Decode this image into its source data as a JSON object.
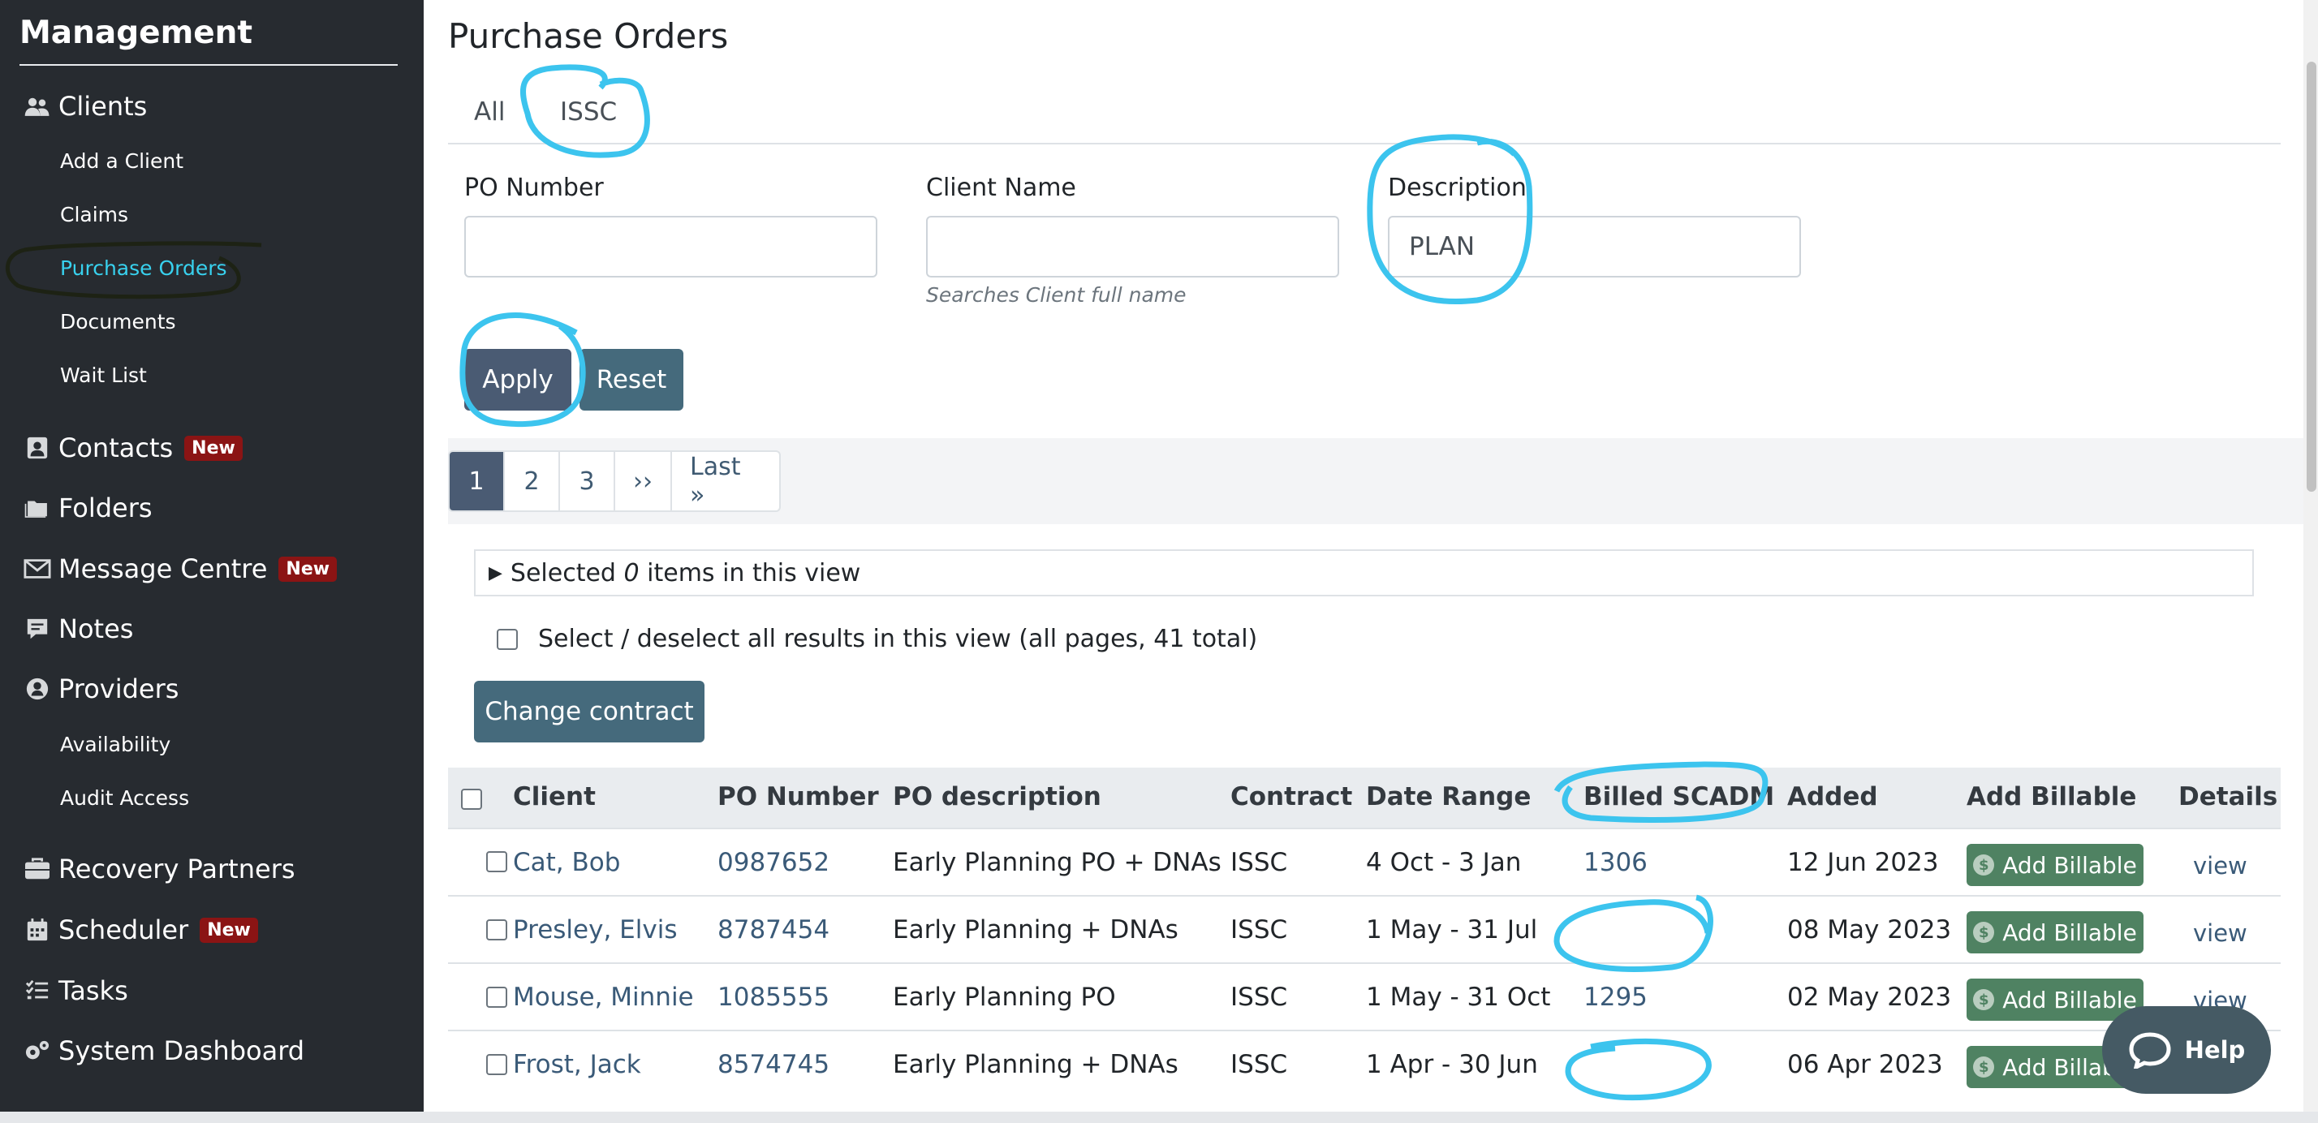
{
  "sidebar": {
    "title": "Management",
    "clients": "Clients",
    "add_client": "Add a Client",
    "claims": "Claims",
    "purchase_orders": "Purchase Orders",
    "documents": "Documents",
    "wait_list": "Wait List",
    "contacts": "Contacts",
    "folders": "Folders",
    "message_centre": "Message Centre",
    "notes": "Notes",
    "providers": "Providers",
    "availability": "Availability",
    "audit_access": "Audit Access",
    "recovery_partners": "Recovery Partners",
    "scheduler": "Scheduler",
    "tasks": "Tasks",
    "system_dashboard": "System Dashboard",
    "new_badge": "New"
  },
  "page": {
    "title": "Purchase Orders"
  },
  "tabs": {
    "all": "All",
    "issc": "ISSC"
  },
  "filters": {
    "po_number_label": "PO Number",
    "po_number_value": "",
    "client_name_label": "Client Name",
    "client_name_value": "",
    "client_name_help": "Searches Client full name",
    "description_label": "Description",
    "description_value": "PLAN",
    "apply": "Apply",
    "reset": "Reset"
  },
  "pagination": {
    "p1": "1",
    "p2": "2",
    "p3": "3",
    "next": "››",
    "last": "Last »"
  },
  "selection": {
    "summary_prefix": "Selected ",
    "count": "0",
    "summary_suffix": " items in this view",
    "select_all": "Select / deselect all results in this view (all pages, 41 total)",
    "change_contract": "Change contract"
  },
  "table": {
    "headers": {
      "client": "Client",
      "po_number": "PO Number",
      "po_description": "PO description",
      "contract": "Contract",
      "date_range": "Date Range",
      "billed": "Billed SCADM",
      "added": "Added",
      "add_billable": "Add Billable",
      "details": "Details"
    },
    "rows": [
      {
        "client": "Cat, Bob",
        "po": "0987652",
        "desc": "Early Planning PO + DNAs",
        "contract": "ISSC",
        "range": "4 Oct - 3 Jan",
        "billed": "1306",
        "added": "12 Jun 2023",
        "add": "Add Billable",
        "view": "view"
      },
      {
        "client": "Presley, Elvis",
        "po": "8787454",
        "desc": "Early Planning + DNAs",
        "contract": "ISSC",
        "range": "1 May - 31 Jul",
        "billed": "",
        "added": "08 May 2023",
        "add": "Add Billable",
        "view": "view"
      },
      {
        "client": "Mouse, Minnie",
        "po": "1085555",
        "desc": "Early Planning PO",
        "contract": "ISSC",
        "range": "1 May - 31 Oct",
        "billed": "1295",
        "added": "02 May 2023",
        "add": "Add Billable",
        "view": "view"
      },
      {
        "client": "Frost, Jack",
        "po": "8574745",
        "desc": "Early Planning + DNAs",
        "contract": "ISSC",
        "range": "1 Apr - 30 Jun",
        "billed": "",
        "added": "06 Apr 2023",
        "add": "Add Billable",
        "view": "view"
      }
    ]
  },
  "help": {
    "label": "Help"
  },
  "colors": {
    "sidebar_bg": "#272b30",
    "active_link": "#38d1ee",
    "badge": "#8b1414",
    "primary_button": "#4a5b73",
    "secondary_button": "#456a7c",
    "billable_button": "#4f8262",
    "annotation_blue": "#3cc4ee",
    "annotation_dark": "#1d2214"
  }
}
